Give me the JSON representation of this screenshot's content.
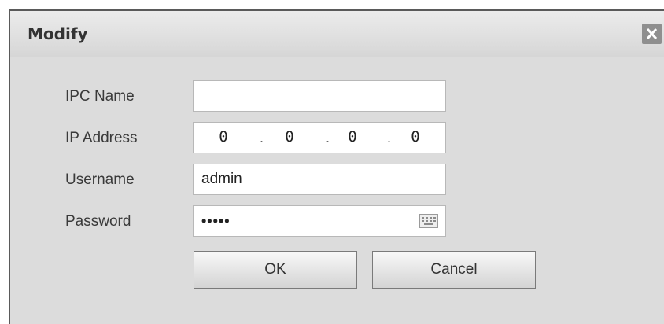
{
  "dialog": {
    "title": "Modify",
    "close_icon": "close-icon"
  },
  "form": {
    "ipc_name_label": "IPC Name",
    "ipc_name_value": "",
    "ip_address_label": "IP Address",
    "ip_octets": [
      "0",
      "0",
      "0",
      "0"
    ],
    "username_label": "Username",
    "username_value": "admin",
    "password_label": "Password",
    "password_value": "•••••",
    "keyboard_icon": "keyboard-icon"
  },
  "buttons": {
    "ok_label": "OK",
    "cancel_label": "Cancel"
  }
}
